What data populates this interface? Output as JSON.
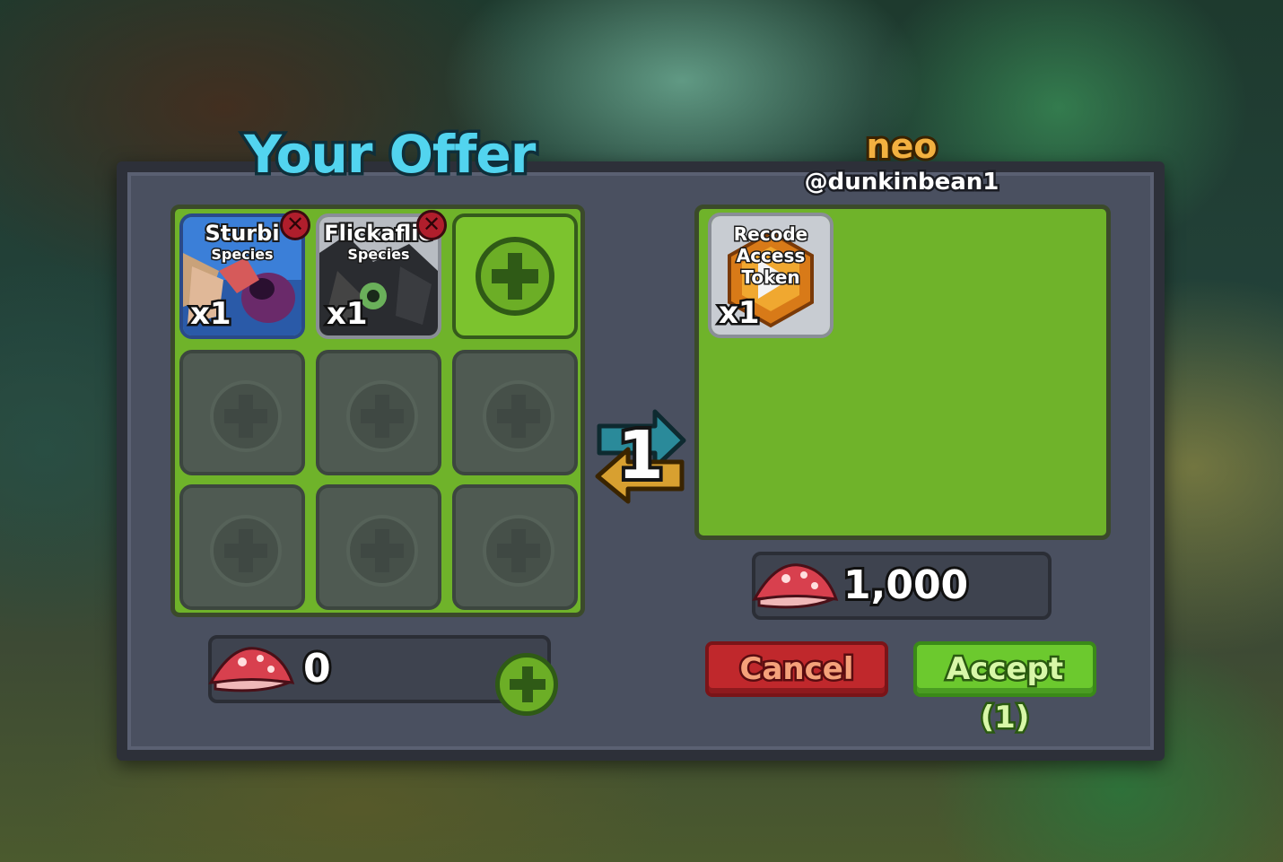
{
  "your_offer": {
    "title": "Your Offer",
    "items": [
      {
        "name": "Sturbi",
        "subtitle": "Species",
        "quantity": "x1"
      },
      {
        "name": "Flickaflie",
        "subtitle": "Species",
        "quantity": "x1"
      }
    ],
    "currency_amount": "0"
  },
  "partner": {
    "display_name": "neo",
    "username": "@dunkinbean1",
    "items": [
      {
        "name_line1": "Recode",
        "name_line2": "Access Token",
        "quantity": "x1"
      }
    ],
    "currency_amount": "1,000"
  },
  "trade_count": "1",
  "buttons": {
    "cancel": "Cancel",
    "accept": "Accept (1)"
  },
  "colors": {
    "title_cyan": "#52d4ef",
    "name_orange": "#f2b040",
    "grid_green": "#6fb32a",
    "cancel_red": "#c0282c",
    "accept_green": "#6cc92e"
  }
}
